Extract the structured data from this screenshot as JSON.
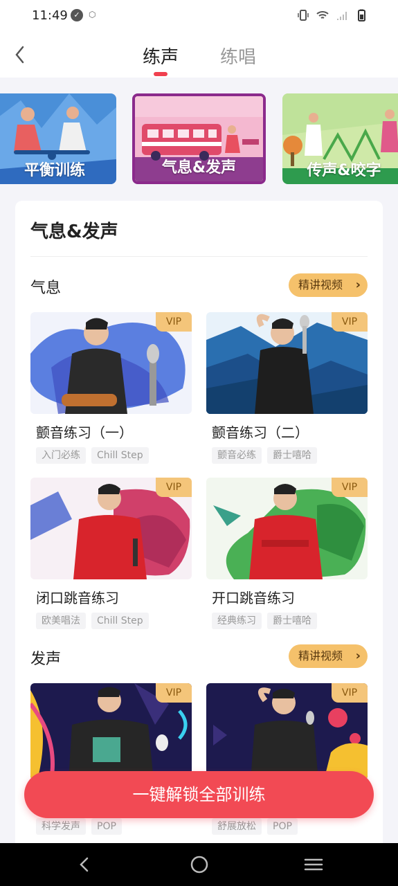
{
  "status_bar": {
    "time": "11:49"
  },
  "header": {
    "tabs": [
      {
        "label": "练声",
        "active": true
      },
      {
        "label": "练唱",
        "active": false
      }
    ]
  },
  "categories": [
    {
      "label": "平衡训练"
    },
    {
      "label": "气息&发声",
      "selected": true
    },
    {
      "label": "传声&咬字"
    }
  ],
  "panel": {
    "title": "气息&发声",
    "sections": [
      {
        "title": "气息",
        "video_button": "精讲视频",
        "courses": [
          {
            "title": "颤音练习（一）",
            "badge": "VIP",
            "tags": [
              "入门必练",
              "Chill Step"
            ]
          },
          {
            "title": "颤音练习（二）",
            "badge": "VIP",
            "tags": [
              "颤音必练",
              "爵士嘻哈"
            ]
          },
          {
            "title": "闭口跳音练习",
            "badge": "VIP",
            "tags": [
              "欧美唱法",
              "Chill Step"
            ]
          },
          {
            "title": "开口跳音练习",
            "badge": "VIP",
            "tags": [
              "经典练习",
              "爵士嘻哈"
            ]
          }
        ]
      },
      {
        "title": "发声",
        "video_button": "精讲视频",
        "courses": [
          {
            "badge": "VIP",
            "tags": [
              "科学发声",
              "POP"
            ]
          },
          {
            "badge": "VIP",
            "tags": [
              "舒展放松",
              "POP"
            ]
          }
        ]
      }
    ]
  },
  "unlock_button": "一键解锁全部训练",
  "colors": {
    "accent": "#f24a54",
    "vip": "#f4c57a",
    "video_button": "#f5c16b"
  }
}
